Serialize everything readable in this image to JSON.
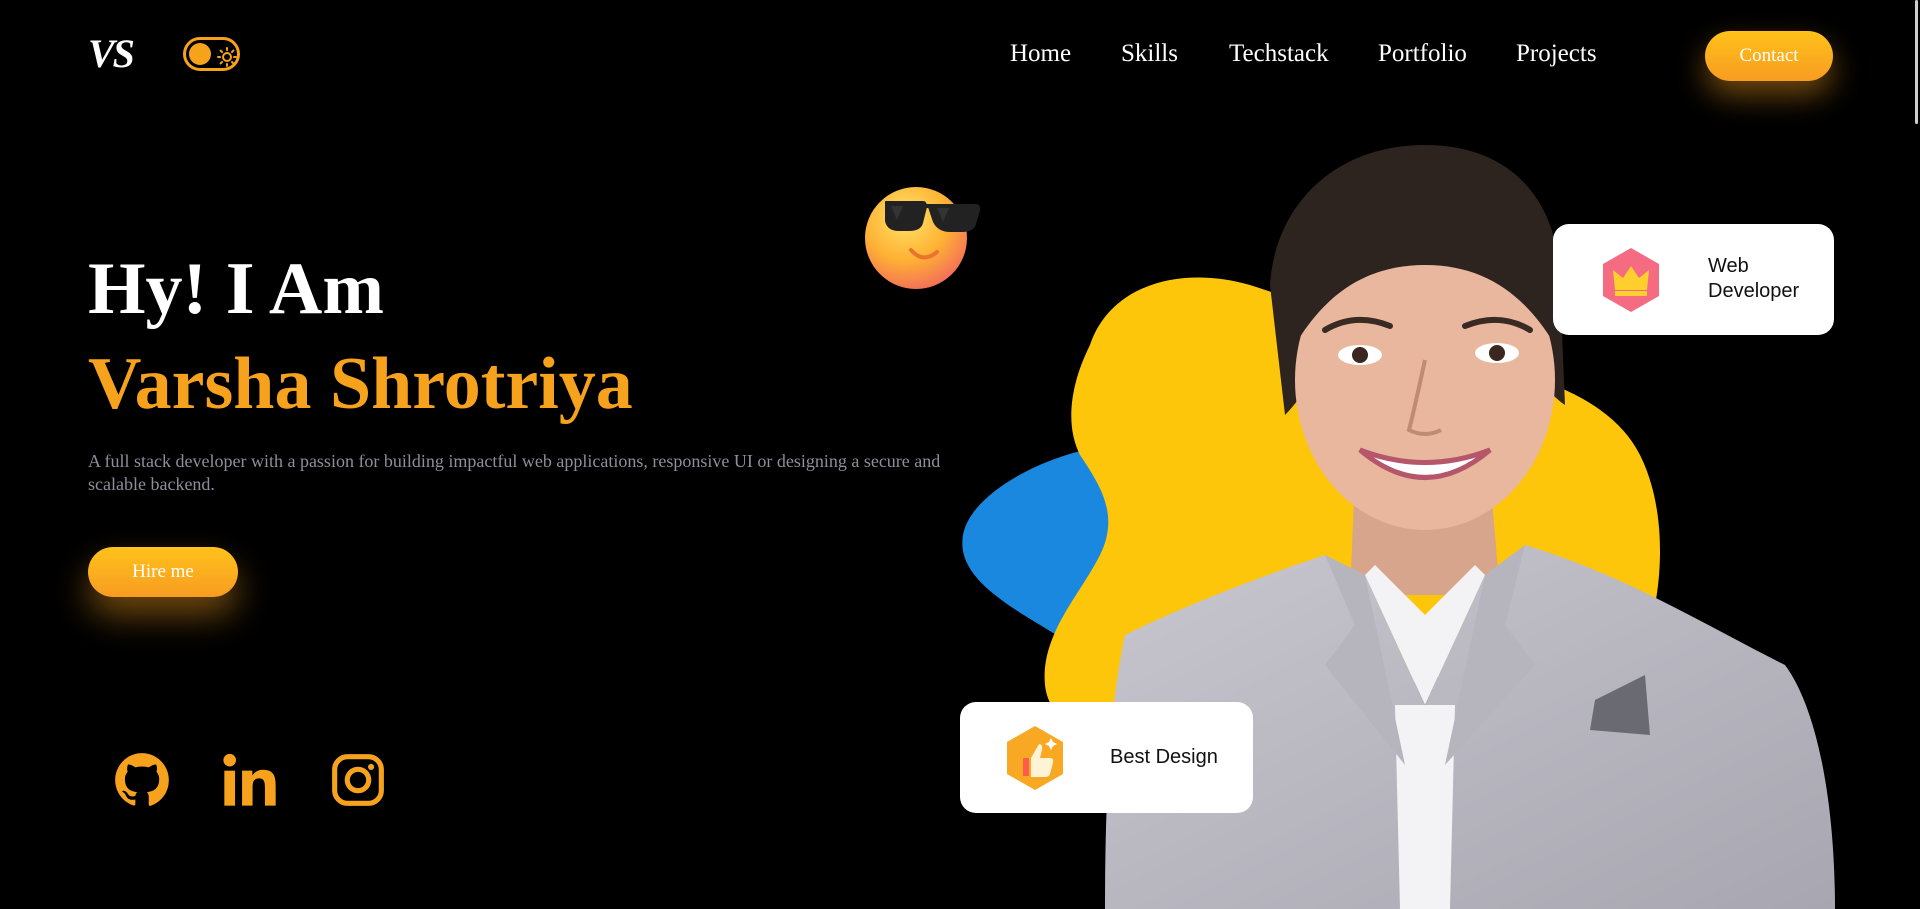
{
  "header": {
    "logo": "VS",
    "nav": [
      {
        "label": "Home"
      },
      {
        "label": "Skills"
      },
      {
        "label": "Techstack"
      },
      {
        "label": "Portfolio"
      },
      {
        "label": "Projects"
      }
    ],
    "contact_label": "Contact"
  },
  "hero": {
    "greeting": "Hy! I Am",
    "name": "Varsha Shrotriya",
    "description": "A full stack developer with a passion for building impactful web applications, responsive UI or designing a secure and scalable backend.",
    "hire_label": "Hire me"
  },
  "social": [
    "github-icon",
    "linkedin-icon",
    "instagram-icon"
  ],
  "cards": {
    "web_developer": "Web\nDeveloper",
    "best_design": "Best Design"
  },
  "colors": {
    "accent": "#f7a21d",
    "background": "#000000",
    "blob_yellow": "#fdc60b",
    "blob_blue": "#1b88e0",
    "muted_text": "#8e8e9c"
  }
}
